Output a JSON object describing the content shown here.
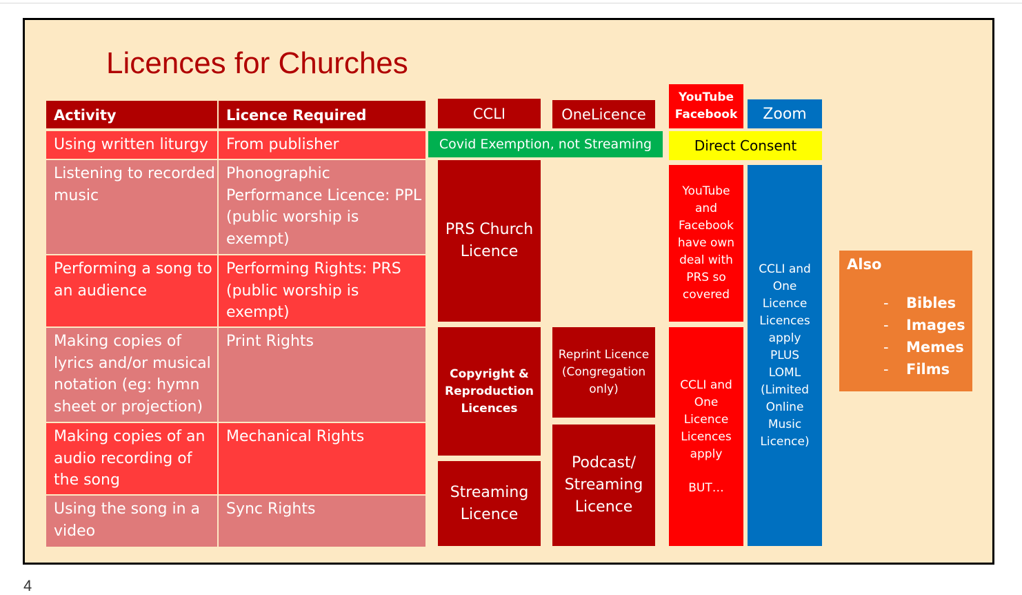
{
  "title": "Licences for Churches",
  "table": {
    "headers": [
      "Activity",
      "Licence Required"
    ],
    "rows": [
      {
        "activity": "Using written liturgy",
        "licence": "From publisher"
      },
      {
        "activity": "Listening to recorded music",
        "licence": "Phonographic Performance Licence: PPL (public worship is exempt)"
      },
      {
        "activity": "Performing a song to an audience",
        "licence": "Performing Rights: PRS (public worship is exempt)"
      },
      {
        "activity": "Making copies of lyrics and/or musical notation (eg: hymn sheet or projection)",
        "licence": "Print Rights"
      },
      {
        "activity": "Making copies of an audio recording of the song",
        "licence": "Mechanical Rights"
      },
      {
        "activity": "Using the song in a video",
        "licence": "Sync Rights"
      }
    ]
  },
  "columns": {
    "ccli": "CCLI",
    "onelicence": "OneLicence",
    "youtube": "YouTube Facebook",
    "zoom": "Zoom"
  },
  "bands": {
    "covid": "Covid Exemption, not Streaming",
    "direct": "Direct Consent"
  },
  "blocks": {
    "prs_church": "PRS Church Licence",
    "copyright": "Copyright & Reproduction Licences",
    "streaming_ccli": "Streaming Licence",
    "reprint": "Reprint Licence (Congregation only)",
    "podcast": "Podcast/ Streaming Licence",
    "yt_covered": "YouTube and Facebook have own deal with PRS so covered",
    "yt_but_1": "CCLI and One Licence Licences apply",
    "yt_but_2": "BUT…",
    "zoom_note": "CCLI and One Licence Licences apply PLUS LOML (Limited Online Music Licence)"
  },
  "also": {
    "title": "Also",
    "items": [
      "Bibles",
      "Images",
      "Memes",
      "Films"
    ]
  },
  "page_number": "4",
  "colors": {
    "slide_bg": "#fde9c4",
    "dark_red": "#b30000",
    "bright_red": "#ff0000",
    "green": "#00b050",
    "yellow": "#ffff00",
    "blue": "#0070c0",
    "orange": "#ed7d31"
  }
}
